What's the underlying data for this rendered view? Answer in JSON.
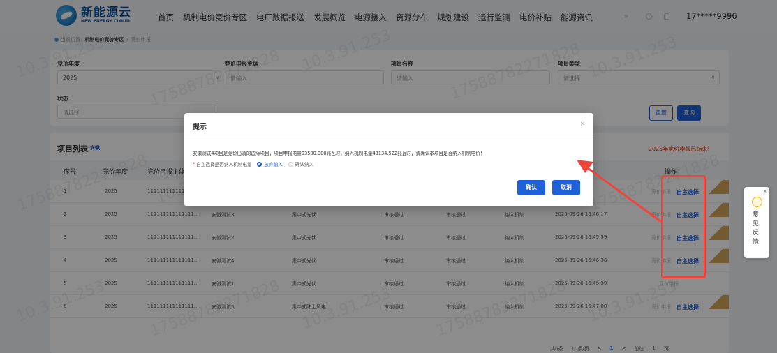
{
  "header": {
    "logo_cn": "新能源云",
    "logo_en": "NEW ENERGY CLOUD",
    "menu": [
      "首页",
      "机制电价竞价专区",
      "电厂数据报送",
      "发展概览",
      "电源接入",
      "资源分布",
      "规划建设",
      "运行监测",
      "电价补贴",
      "能源资讯"
    ],
    "more": "»",
    "user": "17*****9996",
    "user_caret": "∨"
  },
  "breadcrumb": {
    "prefix": "当前位置:",
    "section": "机制电价竞价专区",
    "sep": "/",
    "current": "竞价申报"
  },
  "filters": {
    "year_label": "竞价年度",
    "year_value": "2025",
    "entity_label": "竞价申报主体",
    "entity_placeholder": "请输入",
    "project_label": "项目名称",
    "project_placeholder": "请输入",
    "type_label": "项目类型",
    "type_placeholder": "请选择",
    "status_label": "状态",
    "status_placeholder": "请选择",
    "reset_label": "重置",
    "search_label": "查询"
  },
  "list": {
    "title": "项目列表",
    "region_tag": "安徽",
    "notice": "2025年竞价申报已结束!",
    "columns": [
      "序号",
      "竞价年度",
      "竞价申报主体",
      "操作"
    ],
    "rows": [
      {
        "no": "1",
        "year": "2025",
        "entity": "111111111111",
        "name": "",
        "type": "",
        "s1": "",
        "s2": "",
        "s3": "",
        "time": "46:53",
        "action": "自主选择",
        "status": "竞价申报"
      },
      {
        "no": "2",
        "year": "2025",
        "entity": "111111111111111...",
        "name": "安徽测试3",
        "type": "集中式光伏",
        "s1": "审核通过",
        "s2": "审核通过",
        "s3": "纳入机制",
        "time": "2025-09-26 16:46:17",
        "action": "自主选择",
        "status": "竞价申报"
      },
      {
        "no": "3",
        "year": "2025",
        "entity": "111111111111111...",
        "name": "安徽测试2",
        "type": "集中式光伏",
        "s1": "审核通过",
        "s2": "审核通过",
        "s3": "纳入机制",
        "time": "2025-09-26 16:45:59",
        "action": "自主选择",
        "status": "竞价申报"
      },
      {
        "no": "4",
        "year": "2025",
        "entity": "111111111111111...",
        "name": "安徽测试4",
        "type": "集中式光伏",
        "s1": "审核通过",
        "s2": "审核通过",
        "s3": "纳入机制",
        "time": "2025-09-26 16:46:36",
        "action": "自主选择",
        "status": "竞价申报"
      },
      {
        "no": "5",
        "year": "2025",
        "entity": "111111111111111...",
        "name": "安徽测试1",
        "type": "集中式光伏",
        "s1": "审核通过",
        "s2": "审核通过",
        "s3": "纳入机制",
        "time": "2025-09-26 16:45:39",
        "action": "",
        "status": "竞价申报"
      },
      {
        "no": "6",
        "year": "2025",
        "entity": "111111111111111...",
        "name": "安徽测试5",
        "type": "集中式陆上风电",
        "s1": "审核通过",
        "s2": "审核通过",
        "s3": "纳入机制",
        "time": "2025-09-26 16:47:08",
        "action": "自主选择",
        "status": "竞价申报"
      }
    ],
    "pager": {
      "total": "共6条",
      "size": "10条/页",
      "prev": "<",
      "current": "1",
      "next": ">",
      "goto": "前往",
      "goto_value": "1",
      "page_suffix": "页"
    }
  },
  "modal": {
    "title": "提示",
    "close": "×",
    "message": "安徽测试4项目是竞价出清的边际项目，项目申报电量93500.000兆瓦时，纳入机制电量43134.522兆瓦时，请确认本项目是否纳入机制电价！",
    "question": "自主选择是否纳入机制电量",
    "required_mark": "*",
    "option_giveup": "放弃纳入",
    "option_confirm": "确认纳入",
    "selected": "放弃纳入",
    "ok": "确认",
    "cancel": "取消"
  },
  "feedback": {
    "close": "x",
    "label": "意见反馈"
  },
  "watermark": {
    "phone": "17588782271828",
    "masked": "17*****9996",
    "ip": "10.3.91.253"
  },
  "colors": {
    "primary": "#1f5fd8",
    "highlight": "#f0443a",
    "notice": "#e0301e"
  }
}
